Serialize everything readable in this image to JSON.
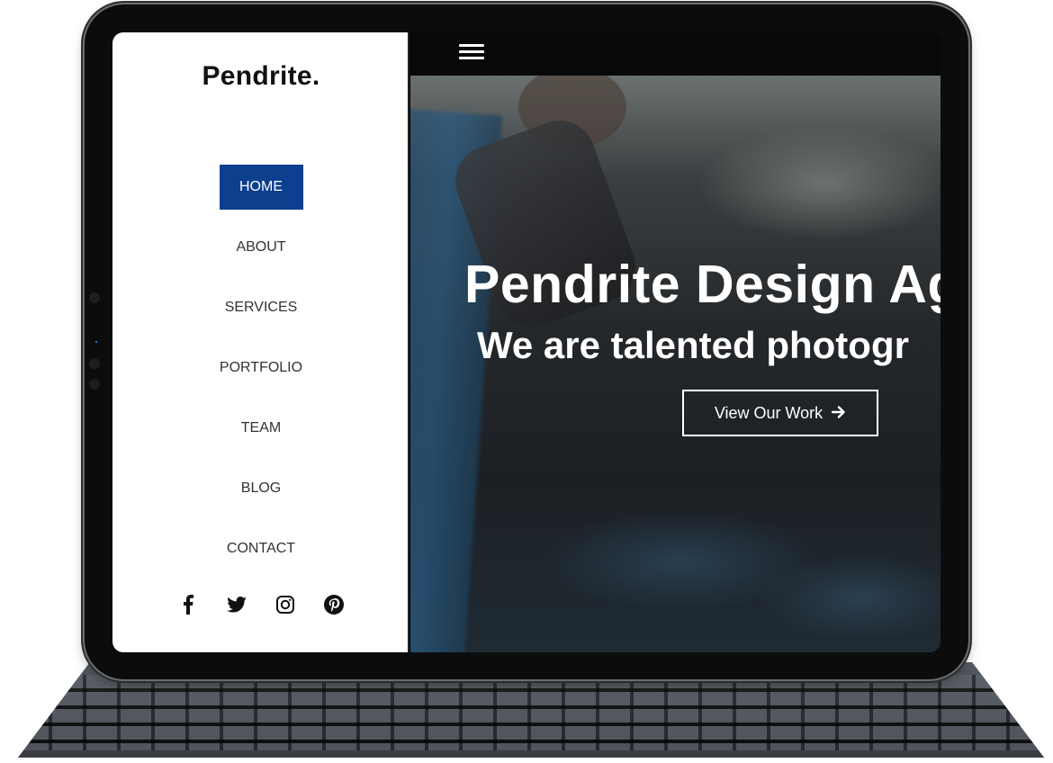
{
  "site": {
    "brand": "Pendrite."
  },
  "nav": {
    "items": [
      {
        "label": "HOME",
        "active": true
      },
      {
        "label": "ABOUT",
        "active": false
      },
      {
        "label": "SERVICES",
        "active": false
      },
      {
        "label": "PORTFOLIO",
        "active": false
      },
      {
        "label": "TEAM",
        "active": false
      },
      {
        "label": "BLOG",
        "active": false
      },
      {
        "label": "CONTACT",
        "active": false
      }
    ],
    "active_color": "#0d3f8f"
  },
  "socials": [
    {
      "icon": "facebook-icon"
    },
    {
      "icon": "twitter-icon"
    },
    {
      "icon": "instagram-icon"
    },
    {
      "icon": "pinterest-icon"
    }
  ],
  "topbar": {
    "menu_icon": "hamburger-menu-icon"
  },
  "hero": {
    "title": "Pendrite Design Ag",
    "subtitle": "We are talented photogr",
    "cta_label": "View Our Work",
    "cta_icon": "arrow-right-icon"
  }
}
